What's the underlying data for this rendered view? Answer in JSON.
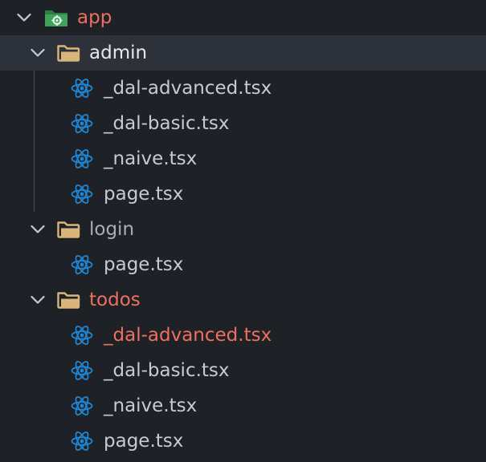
{
  "colors": {
    "background": "#1e2227",
    "selected_row": "#2c313a",
    "text_default": "#c6cbd3",
    "text_modified": "#ef6f5f",
    "text_muted": "#a9aeb6",
    "folder": "#d9b57a",
    "react": "#1f86d6",
    "app_folder": "#3fa35b"
  },
  "explorer": {
    "root": {
      "label": "app",
      "icon": "app-folder-icon"
    },
    "admin": {
      "label": "admin",
      "files": [
        "_dal-advanced.tsx",
        "_dal-basic.tsx",
        "_naive.tsx",
        "page.tsx"
      ]
    },
    "login": {
      "label": "login",
      "files": [
        "page.tsx"
      ]
    },
    "todos": {
      "label": "todos",
      "files": [
        "_dal-advanced.tsx",
        "_dal-basic.tsx",
        "_naive.tsx",
        "page.tsx"
      ]
    }
  }
}
